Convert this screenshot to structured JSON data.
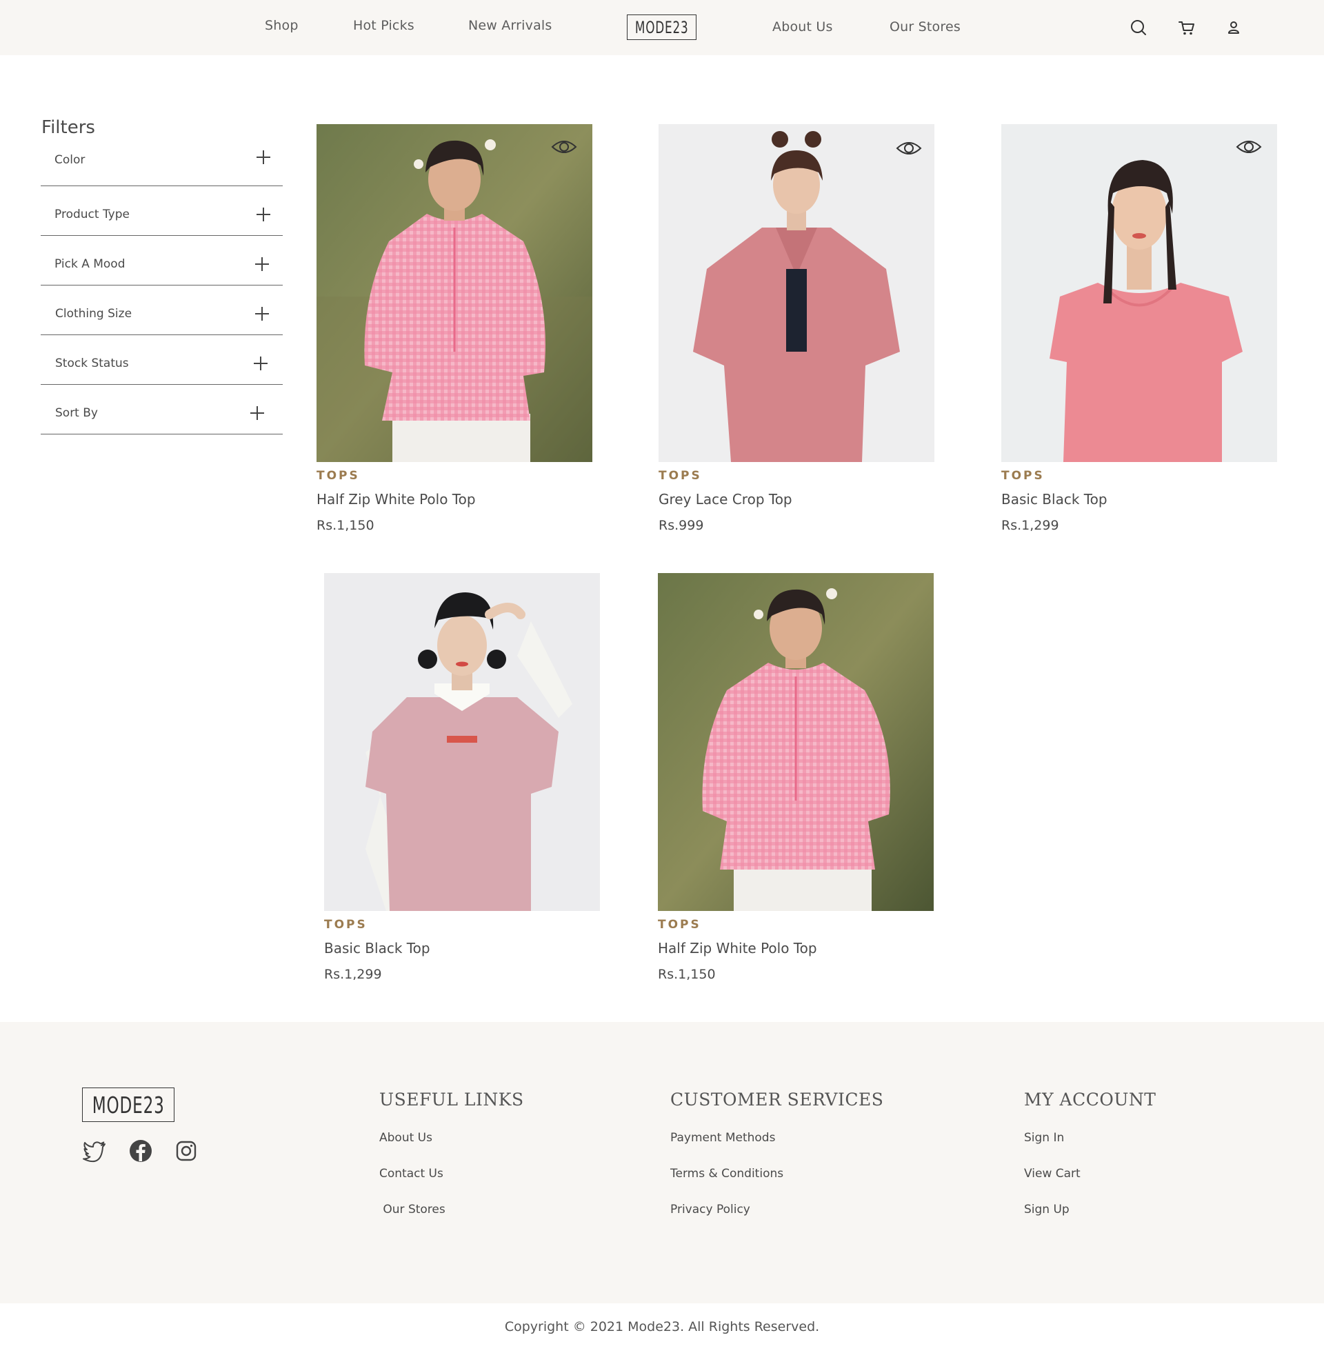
{
  "header": {
    "nav_left": [
      "Shop",
      "Hot Picks",
      "New Arrivals"
    ],
    "logo": "MODE23",
    "nav_right": [
      "About Us",
      "Our Stores"
    ],
    "icons": [
      "search-icon",
      "cart-icon",
      "user-icon"
    ]
  },
  "filters": {
    "title": "Filters",
    "items": [
      "Color",
      "Product Type",
      "Pick A Mood",
      "Clothing Size",
      "Stock Status",
      "Sort By"
    ]
  },
  "products": [
    {
      "category": "TOPS",
      "name": "Half Zip White Polo Top",
      "price": "Rs.1,150",
      "quick_view": true
    },
    {
      "category": "TOPS",
      "name": "Grey Lace Crop Top",
      "price": "Rs.999",
      "quick_view": true
    },
    {
      "category": "TOPS",
      "name": "Basic Black Top",
      "price": "Rs.1,299",
      "quick_view": true
    },
    {
      "category": "TOPS",
      "name": "Basic Black Top",
      "price": "Rs.1,299",
      "quick_view": false
    },
    {
      "category": "TOPS",
      "name": "Half Zip White Polo Top",
      "price": "Rs.1,150",
      "quick_view": false
    }
  ],
  "footer": {
    "logo": "MODE23",
    "social": [
      "twitter-icon",
      "facebook-icon",
      "instagram-icon"
    ],
    "useful_links": {
      "title": "USEFUL LINKS",
      "items": [
        "About Us",
        "Contact Us",
        " Our Stores"
      ]
    },
    "customer_services": {
      "title": "CUSTOMER SERVICES",
      "items": [
        "Payment Methods",
        "Terms & Conditions",
        "Privacy Policy"
      ]
    },
    "my_account": {
      "title": "MY ACCOUNT",
      "items": [
        "Sign In",
        "View Cart",
        "Sign Up"
      ]
    },
    "copyright": "Copyright © 2021 Mode23. All Rights Reserved."
  },
  "colors": {
    "header_bg": "#f8f6f3",
    "category_accent": "#9b7b4f",
    "text": "#4a4a4a"
  }
}
